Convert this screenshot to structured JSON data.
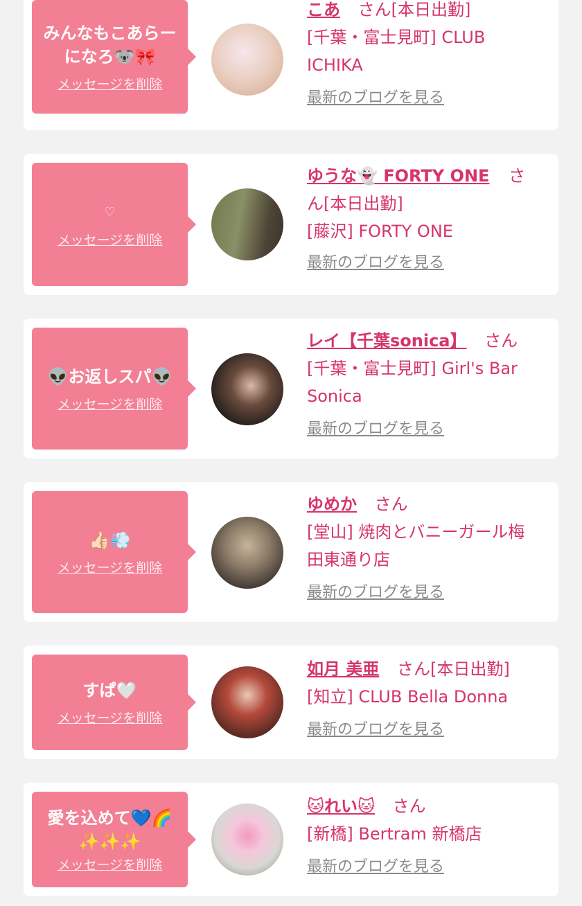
{
  "items": [
    {
      "message": "みんなもこあらーになろ🐨🎀",
      "delete_label": "メッセージを削除",
      "name": "こあ",
      "suffix": "さん[本日出勤]",
      "shop_lines": [
        "[千葉・富士見町] CLUB",
        "ICHIKA"
      ],
      "blog_label": "最新のブログを見る",
      "avatar_colors": [
        "#f6e6ea",
        "#d7a98c"
      ]
    },
    {
      "message": "♡",
      "delete_label": "メッセージを削除",
      "name": "ゆうな👻 FORTY ONE",
      "suffix": "さ",
      "suffix2": "ん[本日出勤]",
      "shop_lines": [
        "[藤沢] FORTY ONE"
      ],
      "blog_label": "最新のブログを見る",
      "avatar_colors": [
        "#6f7a4d",
        "#4e4436"
      ]
    },
    {
      "message": "👽お返しスパ👽",
      "delete_label": "メッセージを削除",
      "name": "レイ【千葉sonica】",
      "suffix": "さん",
      "shop_lines": [
        "[千葉・富士見町] Girl's Bar",
        "Sonica"
      ],
      "blog_label": "最新のブログを見る",
      "avatar_colors": [
        "#2b2320",
        "#6a4b3d"
      ]
    },
    {
      "message": "👍🏻💨",
      "delete_label": "メッセージを削除",
      "name": "ゆめか",
      "suffix": "さん",
      "shop_lines": [
        "[堂山] 焼肉とバニーガール梅",
        "田東通り店"
      ],
      "blog_label": "最新のブログを見る",
      "avatar_colors": [
        "#c7b59a",
        "#3b3430"
      ]
    },
    {
      "message": "すぱ🤍",
      "delete_label": "メッセージを削除",
      "name": "如月 美亜",
      "suffix": "さん[本日出勤]",
      "shop_lines": [
        "[知立] CLUB Bella Donna"
      ],
      "blog_label": "最新のブログを見る",
      "avatar_colors": [
        "#5a2a22",
        "#b44a3c"
      ]
    },
    {
      "message": "愛を込めて💙🌈✨✨✨",
      "delete_label": "メッセージを削除",
      "name": "🐱れい🐱",
      "suffix": "さん",
      "shop_lines": [
        "[新橋] Bertram 新橋店"
      ],
      "blog_label": "最新のブログを見る",
      "avatar_colors": [
        "#d9d7d4",
        "#f09ac0"
      ]
    }
  ]
}
